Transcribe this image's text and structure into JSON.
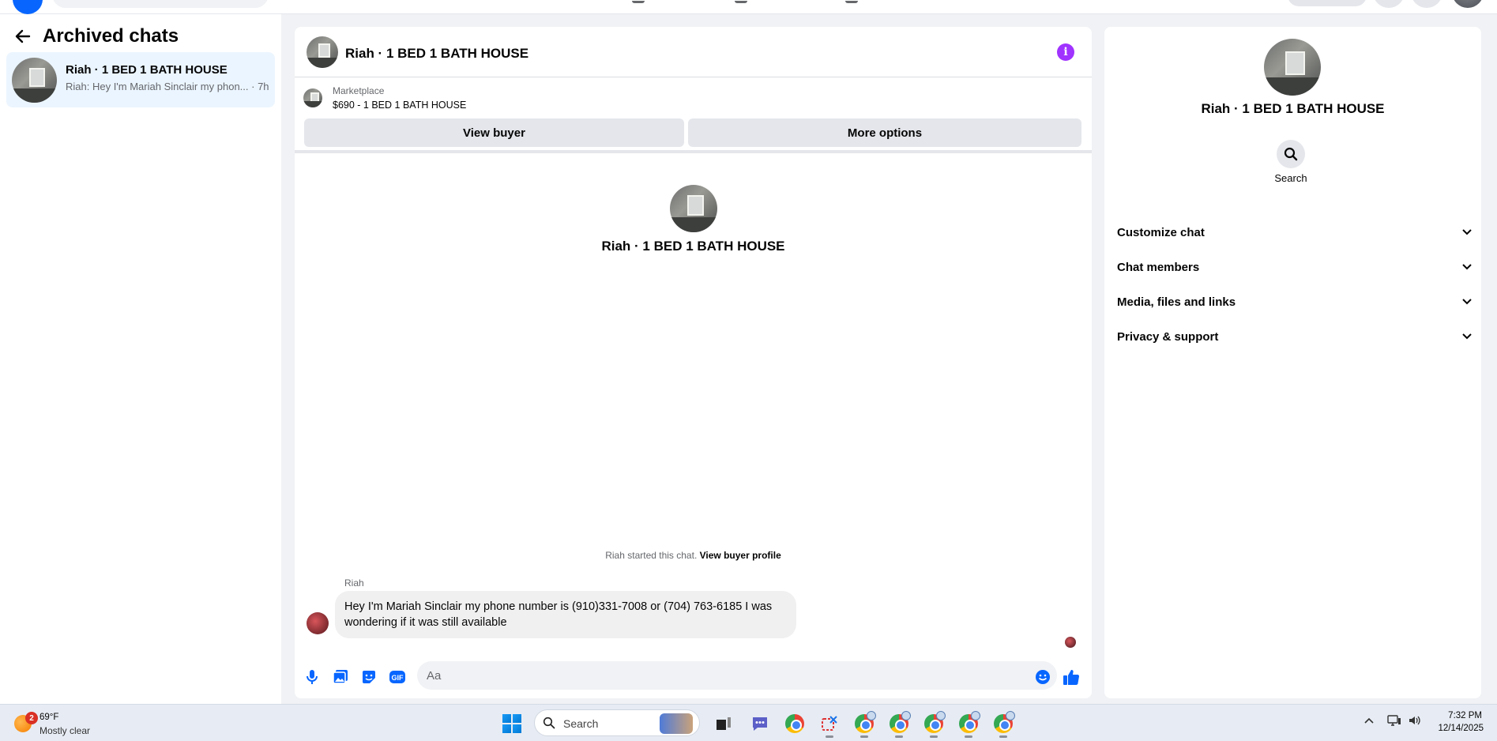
{
  "left_panel": {
    "title": "Archived chats",
    "chat": {
      "name": "Riah · 1 BED 1 BATH HOUSE",
      "preview": "Riah: Hey I'm Mariah Sinclair my phon...",
      "time": "7h"
    }
  },
  "conversation": {
    "header_title": "Riah · 1 BED 1 BATH HOUSE",
    "marketplace_label": "Marketplace",
    "listing": "$690 - 1 BED 1 BATH HOUSE",
    "view_buyer_label": "View buyer",
    "more_options_label": "More options",
    "intro_name": "Riah · 1 BED 1 BATH HOUSE",
    "started_text": "Riah started this chat.",
    "view_buyer_profile_link": "View buyer profile",
    "message": {
      "sender": "Riah",
      "text": "Hey I'm Mariah Sinclair my phone number is (910)331-7008 or (704) 763-6185 I was wondering if it was still available"
    },
    "composer_placeholder": "Aa"
  },
  "details_panel": {
    "name": "Riah · 1 BED 1 BATH HOUSE",
    "search_label": "Search",
    "sections": [
      "Customize chat",
      "Chat members",
      "Media, files and links",
      "Privacy & support"
    ]
  },
  "taskbar": {
    "weather_temp": "69°F",
    "weather_desc": "Mostly clear",
    "weather_badge": "2",
    "search_label": "Search",
    "time": "7:32 PM",
    "date": "12/14/2025"
  },
  "colors": {
    "accent": "#0866ff",
    "info_purple": "#a033ff",
    "selected_chat_bg": "#ebf5ff"
  }
}
